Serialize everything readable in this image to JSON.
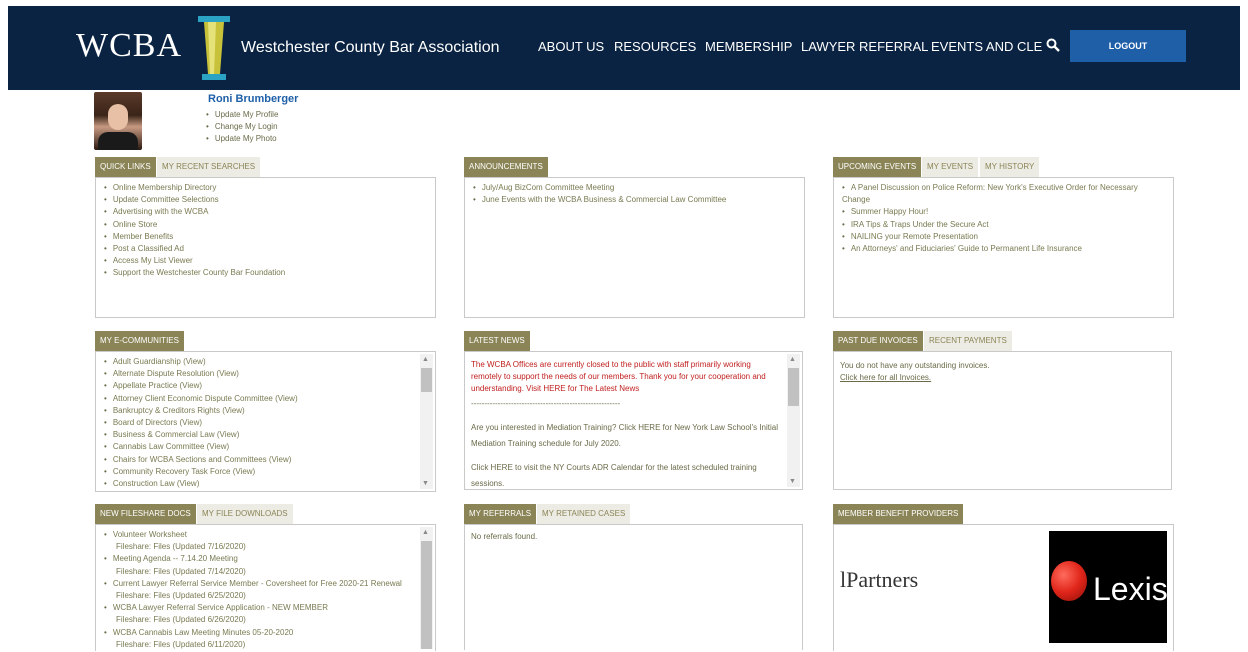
{
  "header": {
    "logo_text": "WCBA",
    "org_name": "Westchester County Bar Association",
    "nav": [
      "ABOUT US",
      "RESOURCES",
      "MEMBERSHIP",
      "LAWYER REFERRAL",
      "EVENTS AND CLE"
    ],
    "logout_label": "LOGOUT",
    "color_bar": "#0a2342",
    "color_button": "#1e5fa8"
  },
  "profile": {
    "name": "Roni Brumberger",
    "links": [
      "Update My Profile",
      "Change My Login",
      "Update My Photo"
    ]
  },
  "quick_links": {
    "tabs": [
      "QUICK LINKS",
      "MY RECENT SEARCHES"
    ],
    "items": [
      "Online Membership Directory",
      "Update Committee Selections",
      "Advertising with the WCBA",
      "Online Store",
      "Member Benefits",
      "Post a Classified Ad",
      "Access My List Viewer",
      "Support the Westchester County Bar Foundation"
    ]
  },
  "announcements": {
    "tabs": [
      "ANNOUNCEMENTS"
    ],
    "items": [
      "July/Aug BizCom Committee Meeting",
      "June Events with the WCBA Business & Commercial Law Committee"
    ]
  },
  "upcoming_events": {
    "tabs": [
      "UPCOMING EVENTS",
      "MY EVENTS",
      "MY HISTORY"
    ],
    "items": [
      "A Panel Discussion on Police Reform: New York's Executive Order for Necessary Change",
      "Summer Happy Hour!",
      "IRA Tips & Traps Under the Secure Act",
      "NAILING your Remote Presentation",
      "An Attorneys' and Fiduciaries' Guide to Permanent Life Insurance"
    ]
  },
  "e_communities": {
    "tabs": [
      "MY E-COMMUNITIES"
    ],
    "items": [
      "Adult Guardianship (View)",
      "Alternate Dispute Resolution (View)",
      "Appellate Practice (View)",
      "Attorney Client Economic Dispute Committee (View)",
      "Bankruptcy & Creditors Rights (View)",
      "Board of Directors (View)",
      "Business & Commercial Law (View)",
      "Cannabis Law Committee (View)",
      "Chairs for WCBA Sections and Committees (View)",
      "Community Recovery Task Force (View)",
      "Construction Law (View)"
    ]
  },
  "latest_news": {
    "tabs": [
      "LATEST NEWS"
    ],
    "notice": "The WCBA Offices are currently closed to the public with staff  primarily working remotely to support the needs of our members. Thank you for your cooperation and understanding. Visit HERE for The Latest News",
    "divider": "--------------------------------------------------------",
    "p1": "Are you interested in Mediation Training? Click HERE for New York Law School's Initial Mediation Training schedule for July 2020.",
    "p2": "Click HERE to visit the NY Courts ADR Calendar for the latest scheduled training sessions."
  },
  "invoices": {
    "tabs": [
      "PAST DUE INVOICES",
      "RECENT PAYMENTS"
    ],
    "text": "You do not have any outstanding invoices.",
    "link": "Click here for all Invoices."
  },
  "fileshare": {
    "tabs": [
      "NEW FILESHARE DOCS",
      "MY FILE DOWNLOADS"
    ],
    "items": [
      {
        "title": "Volunteer Worksheet",
        "meta": "Fileshare: Files (Updated 7/16/2020)"
      },
      {
        "title": "Meeting Agenda -- 7.14.20 Meeting",
        "meta": "Fileshare: Files (Updated 7/14/2020)"
      },
      {
        "title": "Current Lawyer Referral Service Member - Coversheet for Free 2020-21 Renewal",
        "meta": "Fileshare: Files (Updated 6/25/2020)"
      },
      {
        "title": "WCBA Lawyer Referral Service Application - NEW MEMBER",
        "meta": "Fileshare: Files (Updated 6/26/2020)"
      },
      {
        "title": "WCBA Cannabis Law Meeting Minutes 05-20-2020",
        "meta": "Fileshare: Files (Updated 6/11/2020)"
      }
    ]
  },
  "referrals": {
    "tabs": [
      "MY REFERRALS",
      "MY RETAINED CASES"
    ],
    "text": "No referrals found."
  },
  "benefit_providers": {
    "tabs": [
      "MEMBER BENEFIT PROVIDERS"
    ],
    "partners_text": "lPartners",
    "lexis_text": "Lexisl"
  }
}
